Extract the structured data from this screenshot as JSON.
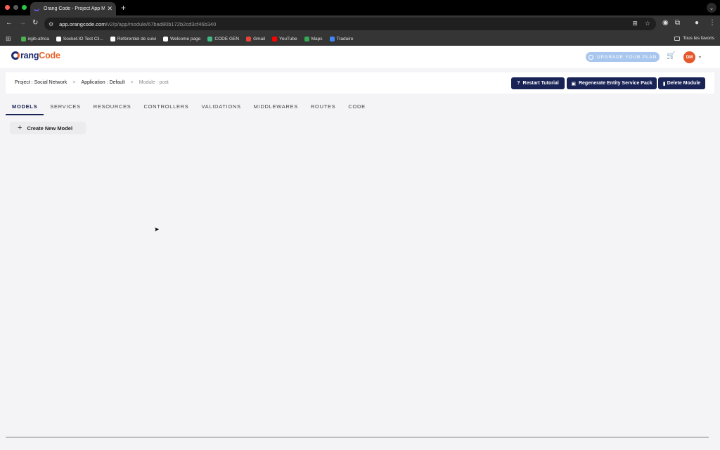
{
  "browser": {
    "tab_title": "Orang Code - Project App M",
    "url_host": "app.orangcode.com",
    "url_path": "/v2/p/app/module/67bad80b172b2cd3cf46b340",
    "bookmarks": [
      {
        "label": "irgib-africa",
        "color": "#4caf50"
      },
      {
        "label": "Socket.IO Test Cli...",
        "color": "#ffffff"
      },
      {
        "label": "Référentiel de suivi",
        "color": "#ffffff"
      },
      {
        "label": "Welcome page",
        "color": "#ffffff"
      },
      {
        "label": "CODE GEN",
        "color": "#41b883"
      },
      {
        "label": "Gmail",
        "color": "#ea4335"
      },
      {
        "label": "YouTube",
        "color": "#ff0000"
      },
      {
        "label": "Maps",
        "color": "#34a853"
      },
      {
        "label": "Traduire",
        "color": "#4285f4"
      }
    ],
    "all_bookmarks_label": "Tous les favoris"
  },
  "header": {
    "logo_o": "O",
    "logo_rang": "rang",
    "logo_code": "Code",
    "upgrade_label": "UPGRADE YOUR PLAN",
    "avatar_initials": "DM"
  },
  "breadcrumb": {
    "project": "Project : Social Network",
    "sep1": ">",
    "application": "Application : Default",
    "sep2": ">",
    "module": "Module : post"
  },
  "actions": {
    "restart": "Restart Tutorial",
    "regenerate": "Regenerate Entity Service Pack",
    "delete": "Delete Module"
  },
  "tabs": [
    "MODELS",
    "SERVICES",
    "RESOURCES",
    "CONTROLLERS",
    "VALIDATIONS",
    "MIDDLEWARES",
    "ROUTES",
    "CODE"
  ],
  "active_tab": "MODELS",
  "create_button": "Create New Model",
  "colors": {
    "primary": "#1a2356",
    "accent": "#e8632a",
    "upgrade": "#a9c7ee"
  }
}
